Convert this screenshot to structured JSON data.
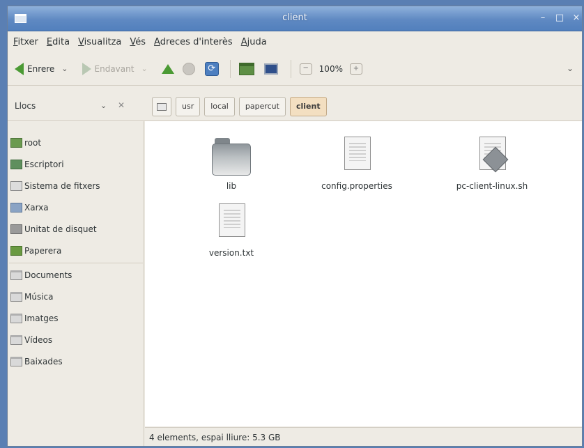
{
  "window": {
    "title": "client",
    "controls": {
      "minimize": "–",
      "maximize": "□",
      "close": "×"
    }
  },
  "menu": [
    "Fitxer",
    "Edita",
    "Visualitza",
    "Vés",
    "Adreces d'interès",
    "Ajuda"
  ],
  "toolbar": {
    "back_label": "Enrere",
    "forward_label": "Endavant",
    "caret": "⌄",
    "zoom_out_symbol": "−",
    "zoom_level": "100%",
    "zoom_in_symbol": "+",
    "overflow": "⌄",
    "icons": [
      "go-back-icon",
      "go-forward-icon",
      "go-up-icon",
      "stop-icon",
      "reload-icon",
      "home-icon",
      "computer-icon",
      "zoom-out-icon",
      "zoom-in-icon"
    ]
  },
  "location": {
    "places_label": "Llocs",
    "places_caret": "⌄",
    "close_symbol": "✕",
    "crumbs": [
      "usr",
      "local",
      "papercut",
      "client"
    ]
  },
  "sidebar": {
    "items": [
      {
        "label": "root",
        "icon": "home-folder-icon"
      },
      {
        "label": "Escriptori",
        "icon": "desktop-icon"
      },
      {
        "label": "Sistema de fitxers",
        "icon": "drive-icon"
      },
      {
        "label": "Xarxa",
        "icon": "network-icon"
      },
      {
        "label": "Unitat de disquet",
        "icon": "floppy-icon"
      },
      {
        "label": "Paperera",
        "icon": "trash-icon"
      },
      {
        "label": "Documents",
        "icon": "folder-icon"
      },
      {
        "label": "Música",
        "icon": "folder-icon"
      },
      {
        "label": "Imatges",
        "icon": "folder-icon"
      },
      {
        "label": "Vídeos",
        "icon": "folder-icon"
      },
      {
        "label": "Baixades",
        "icon": "folder-icon"
      }
    ]
  },
  "files": [
    {
      "name": "lib",
      "type": "folder-icon"
    },
    {
      "name": "config.properties",
      "type": "text-file-icon"
    },
    {
      "name": "pc-client-linux.sh",
      "type": "script-file-icon"
    },
    {
      "name": "version.txt",
      "type": "text-file-icon"
    }
  ],
  "status": "4 elements, espai lliure: 5.3 GB",
  "colors": {
    "titlebar": "#5f89c2",
    "window_bg": "#eeebe4",
    "active_crumb": "#f3dfc1",
    "go_arrow": "#4b9a34"
  }
}
